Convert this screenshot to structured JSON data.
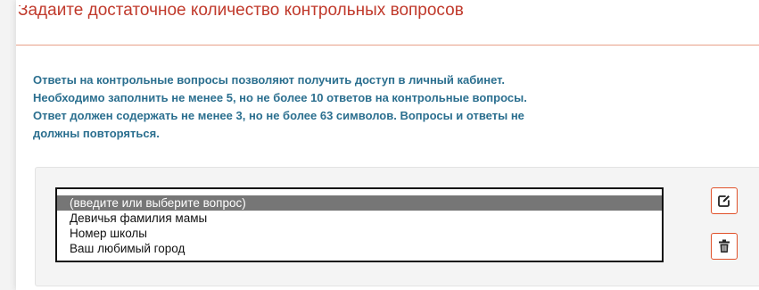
{
  "header": {
    "title": "Задайте достаточное количество контрольных вопросов"
  },
  "info": {
    "lines": [
      "Ответы на контрольные вопросы позволяют получить доступ в личный кабинет.",
      "Необходимо заполнить не менее 5, но не более 10 ответов на контрольные вопросы.",
      "Ответ должен содержать не менее 3, но не более 63 символов. Вопросы и ответы не",
      "должны повторяться."
    ]
  },
  "question_list": {
    "options": [
      "(введите или выберите вопрос)",
      "Девичья фамилия мамы",
      "Номер школы",
      "Ваш любимый город"
    ],
    "selected_index": 0
  },
  "actions": {
    "edit_icon": "edit-icon",
    "delete_icon": "trash-icon"
  },
  "colors": {
    "title": "#c0392b",
    "info_text": "#2b6f8f",
    "accent_border": "#e0512a",
    "selected_bg": "#767676"
  }
}
